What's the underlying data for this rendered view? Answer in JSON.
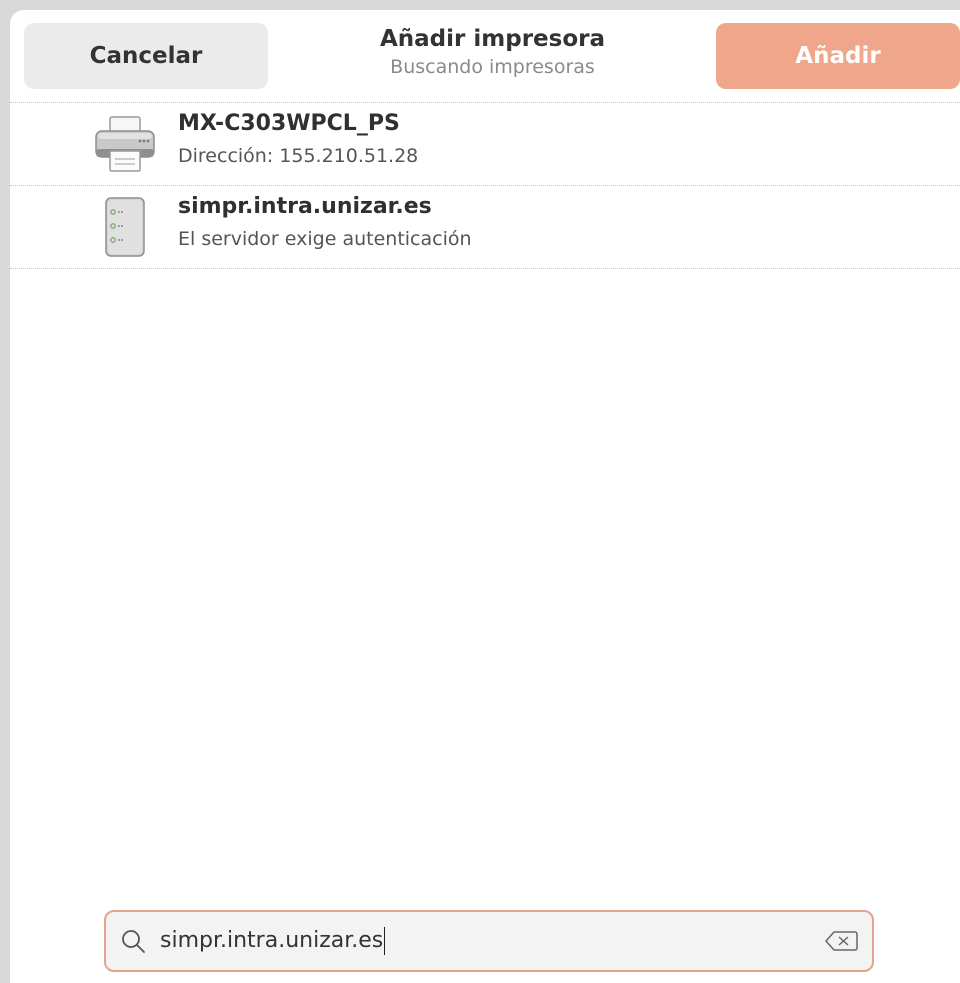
{
  "header": {
    "cancel_label": "Cancelar",
    "title": "Añadir impresora",
    "subtitle": "Buscando impresoras",
    "add_label": "Añadir"
  },
  "printers": [
    {
      "name": "MX-C303WPCL_PS",
      "detail": "Dirección: 155.210.51.28",
      "icon": "printer-icon"
    },
    {
      "name": "simpr.intra.unizar.es",
      "detail": "El servidor exige autenticación",
      "icon": "server-icon"
    }
  ],
  "search": {
    "value": "simpr.intra.unizar.es",
    "icon": "search-icon",
    "clear_icon": "clear-text-icon"
  },
  "colors": {
    "accent": "#f0a68a",
    "accent_border": "#e2a58b"
  }
}
